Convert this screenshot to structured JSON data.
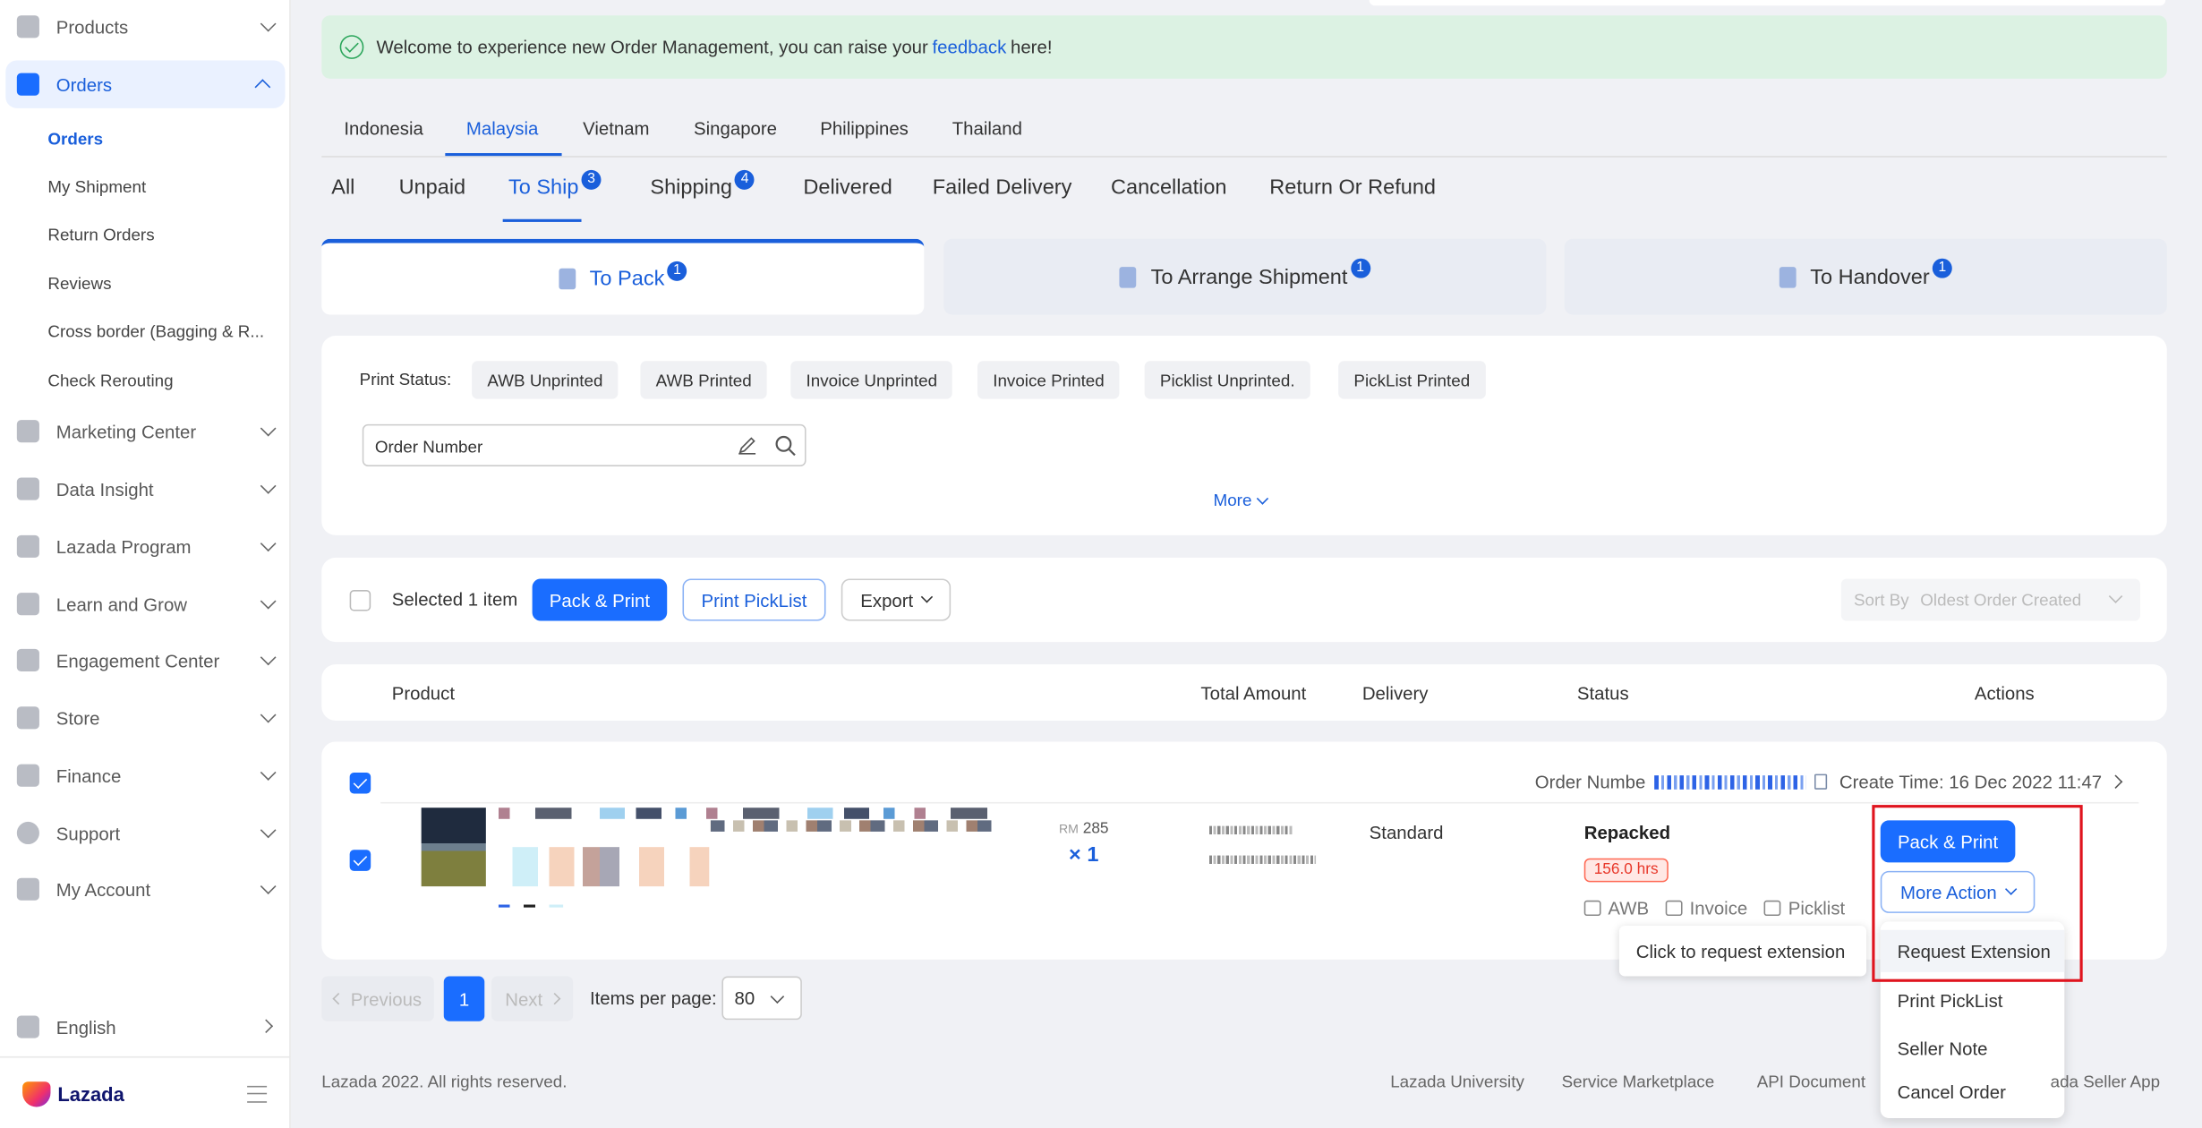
{
  "sidebar": {
    "items": [
      {
        "label": "Products"
      },
      {
        "label": "Orders"
      },
      {
        "label": "Marketing Center"
      },
      {
        "label": "Data Insight"
      },
      {
        "label": "Lazada Program"
      },
      {
        "label": "Learn and Grow"
      },
      {
        "label": "Engagement Center"
      },
      {
        "label": "Store"
      },
      {
        "label": "Finance"
      },
      {
        "label": "Support"
      },
      {
        "label": "My Account"
      }
    ],
    "orders_sub": [
      "Orders",
      "My Shipment",
      "Return Orders",
      "Reviews",
      "Cross border (Bagging & R...",
      "Check Rerouting"
    ],
    "language": "English",
    "logo": "Lazada"
  },
  "banner": {
    "text_before": "Welcome to experience new Order Management, you can raise your",
    "link": "feedback",
    "text_after": "here!"
  },
  "country_tabs": [
    "Indonesia",
    "Malaysia",
    "Vietnam",
    "Singapore",
    "Philippines",
    "Thailand"
  ],
  "status_tabs": [
    {
      "label": "All",
      "badge": ""
    },
    {
      "label": "Unpaid",
      "badge": ""
    },
    {
      "label": "To Ship",
      "badge": "3"
    },
    {
      "label": "Shipping",
      "badge": "4"
    },
    {
      "label": "Delivered",
      "badge": ""
    },
    {
      "label": "Failed Delivery",
      "badge": ""
    },
    {
      "label": "Cancellation",
      "badge": ""
    },
    {
      "label": "Return Or Refund",
      "badge": ""
    }
  ],
  "sub_tabs": [
    {
      "label": "To Pack",
      "badge": "1"
    },
    {
      "label": "To Arrange Shipment",
      "badge": "1"
    },
    {
      "label": "To Handover",
      "badge": "1"
    }
  ],
  "filters": {
    "print_status_label": "Print Status:",
    "chips": [
      "AWB Unprinted",
      "AWB Printed",
      "Invoice Unprinted",
      "Invoice Printed",
      "Picklist Unprinted.",
      "PickList Printed"
    ],
    "search_value": "Order Number",
    "more": "More"
  },
  "action_bar": {
    "selected_text": "Selected 1 item",
    "pack_print": "Pack & Print",
    "print_picklist": "Print PickList",
    "export": "Export",
    "sort_label": "Sort By",
    "sort_value": "Oldest Order Created"
  },
  "table_headers": [
    "Product",
    "Total Amount",
    "Delivery",
    "Status",
    "Actions"
  ],
  "order": {
    "order_number_label": "Order Numbe",
    "create_time": "Create Time: 16 Dec 2022 11:47",
    "currency": "RM",
    "amount": "285",
    "qty": "× 1",
    "delivery": "Standard",
    "status": "Repacked",
    "hours": "156.0 hrs",
    "print_links": [
      "AWB",
      "Invoice",
      "Picklist"
    ],
    "pack_print": "Pack & Print",
    "more_action": "More Action"
  },
  "tooltip": "Click to request extension",
  "more_action_menu": [
    "Request Extension",
    "Print PickList",
    "Seller Note",
    "Cancel Order"
  ],
  "pagination": {
    "previous": "Previous",
    "page": "1",
    "next": "Next",
    "items_per_page": "Items per page:",
    "per_page_value": "80"
  },
  "footer": {
    "copyright": "Lazada 2022. All rights reserved.",
    "links": [
      "Lazada University",
      "Service Marketplace",
      "API Document",
      "ada Seller App"
    ]
  },
  "colors": {
    "accent": "#1a6dff",
    "highlight_box": "#e0141e",
    "banner_bg": "#dcf2e3"
  }
}
